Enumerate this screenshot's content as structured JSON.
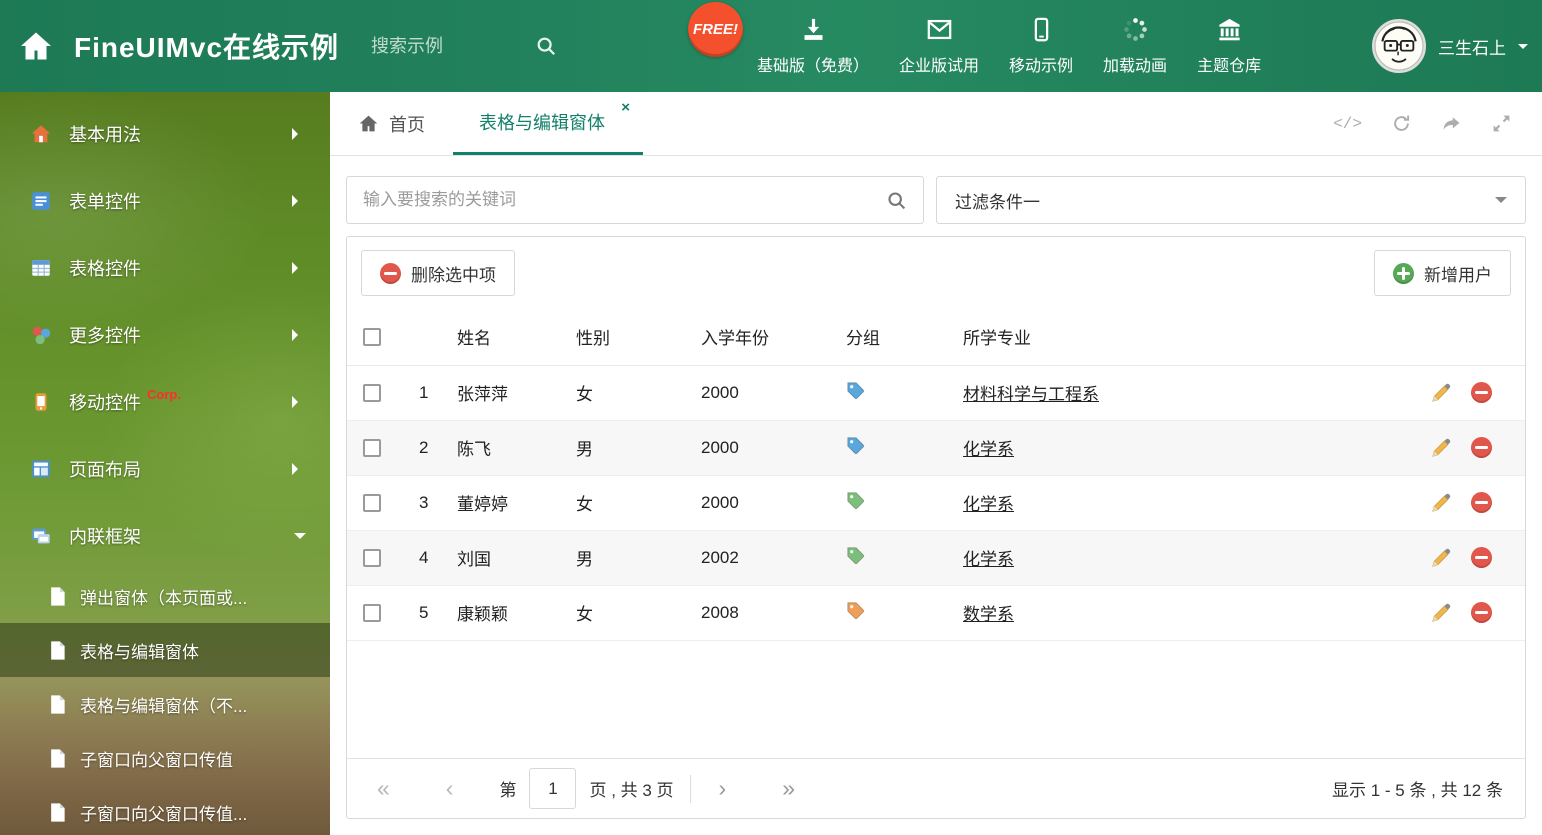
{
  "colors": {
    "header_bg": "#217f5c",
    "accent_teal": "#13806b",
    "free_badge_bg": "#f4502e",
    "sidebar_active_overlay": "rgba(25,40,12,0.45)",
    "delete_red": "#e2574c",
    "add_green": "#57a957",
    "pencil_orange": "#f0b64e",
    "row_stripe": "#f7f7f7"
  },
  "header": {
    "title": "FineUIMvc在线示例",
    "search_placeholder": "搜索示例",
    "free_badge": "FREE!",
    "nav_items": [
      {
        "label": "基础版（免费）",
        "icon": "download-icon"
      },
      {
        "label": "企业版试用",
        "icon": "envelope-icon"
      },
      {
        "label": "移动示例",
        "icon": "mobile-icon"
      },
      {
        "label": "加载动画",
        "icon": "spinner-icon"
      },
      {
        "label": "主题仓库",
        "icon": "bank-icon"
      }
    ],
    "username": "三生石上"
  },
  "sidebar": {
    "items": [
      {
        "label": "基本用法"
      },
      {
        "label": "表单控件"
      },
      {
        "label": "表格控件"
      },
      {
        "label": "更多控件"
      },
      {
        "label": "移动控件",
        "badge": "Corp."
      },
      {
        "label": "页面布局"
      },
      {
        "label": "内联框架",
        "expanded": true
      }
    ],
    "subitems": [
      {
        "label": "弹出窗体（本页面或..."
      },
      {
        "label": "表格与编辑窗体",
        "active": true
      },
      {
        "label": "表格与编辑窗体（不..."
      },
      {
        "label": "子窗口向父窗口传值"
      },
      {
        "label": "子窗口向父窗口传值..."
      }
    ]
  },
  "tabs": {
    "home": "首页",
    "active": "表格与编辑窗体"
  },
  "filters": {
    "search_placeholder": "输入要搜索的关键词",
    "filter_selected": "过滤条件一"
  },
  "toolbar": {
    "delete": "删除选中项",
    "add": "新增用户"
  },
  "table": {
    "headers": {
      "name": "姓名",
      "gender": "性别",
      "year": "入学年份",
      "group": "分组",
      "major": "所学专业"
    },
    "rows": [
      {
        "num": "1",
        "name": "张萍萍",
        "gender": "女",
        "year": "2000",
        "tag_color": "#5aa7dd",
        "major": "材料科学与工程系"
      },
      {
        "num": "2",
        "name": "陈飞",
        "gender": "男",
        "year": "2000",
        "tag_color": "#5aa7dd",
        "major": "化学系"
      },
      {
        "num": "3",
        "name": "董婷婷",
        "gender": "女",
        "year": "2000",
        "tag_color": "#7cbf7c",
        "major": "化学系"
      },
      {
        "num": "4",
        "name": "刘国",
        "gender": "男",
        "year": "2002",
        "tag_color": "#7cbf7c",
        "major": "化学系"
      },
      {
        "num": "5",
        "name": "康颖颖",
        "gender": "女",
        "year": "2008",
        "tag_color": "#f09d57",
        "major": "数学系"
      }
    ]
  },
  "pagination": {
    "page_label": "第",
    "current_page": "1",
    "total_label": "页 , 共 3 页",
    "summary": "显示 1 - 5 条 , 共 12 条"
  }
}
